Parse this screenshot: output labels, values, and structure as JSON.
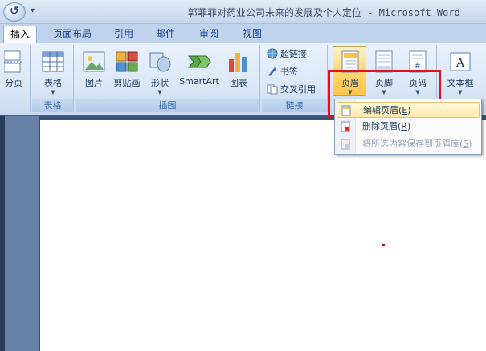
{
  "window": {
    "title": "郭菲菲对药业公司未来的发展及个人定位 - Microsoft Word"
  },
  "quick_access": {
    "office_button_icon": "office-orb-icon",
    "customize_icon": "dropdown-arrow-icon"
  },
  "tabs": [
    {
      "label": "插入",
      "active": true
    },
    {
      "label": "页面布局"
    },
    {
      "label": "引用"
    },
    {
      "label": "邮件"
    },
    {
      "label": "审阅"
    },
    {
      "label": "视图"
    }
  ],
  "ribbon": {
    "pages_group": {
      "partial_label": "分页"
    },
    "table_group": {
      "label": "表格",
      "button": "表格"
    },
    "illustrations": {
      "label": "插图",
      "buttons": [
        "图片",
        "剪贴画",
        "形状",
        "SmartArt",
        "图表"
      ]
    },
    "links": {
      "label": "链接",
      "items": [
        "超链接",
        "书签",
        "交叉引用"
      ]
    },
    "header_footer": {
      "buttons": [
        "页眉",
        "页脚",
        "页码"
      ]
    },
    "text_group": {
      "button": "文本框"
    }
  },
  "header_menu": {
    "items": [
      {
        "label": "编辑页眉",
        "accel": "E",
        "highlighted": true,
        "disabled": false
      },
      {
        "label": "删除页眉",
        "accel": "R",
        "highlighted": false,
        "disabled": false
      },
      {
        "label": "将所选内容保存到页眉库",
        "accel": "S",
        "highlighted": false,
        "disabled": true
      }
    ]
  },
  "colors": {
    "annotation_red": "#e3111b",
    "ribbon_blue": "#dbe7f7"
  }
}
